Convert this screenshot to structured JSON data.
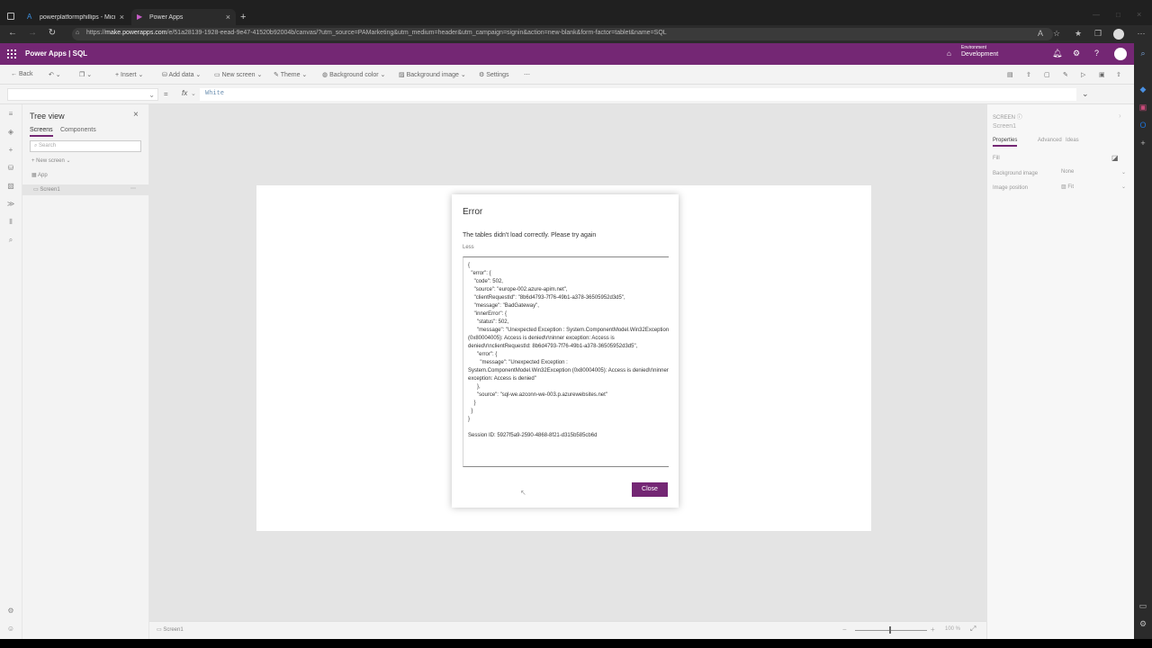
{
  "browser": {
    "tabs": [
      {
        "title": "powerplatformphillips - Microsoft..."
      },
      {
        "title": "Power Apps"
      }
    ],
    "url_prefix": "https://",
    "url_domain": "make.powerapps.com",
    "url_rest": "/e/51a28139-1928-eead-9e47-41520b92004b/canvas/?utm_source=PAMarketing&utm_medium=header&utm_campaign=signin&action=new-blank&form-factor=tablet&name=SQL"
  },
  "app": {
    "title": "Power Apps  |  SQL",
    "env_label": "Environment",
    "env_name": "Development"
  },
  "commands": {
    "back": "Back",
    "insert": "Insert",
    "add_data": "Add data",
    "new_screen": "New screen",
    "theme": "Theme",
    "background_color": "Background color",
    "background_image": "Background image",
    "settings": "Settings"
  },
  "formula": {
    "fx": "fx",
    "value": "White"
  },
  "tree": {
    "title": "Tree view",
    "tabs": [
      "Screens",
      "Components"
    ],
    "search_placeholder": "Search",
    "new_screen": "New screen",
    "items": [
      {
        "label": "App"
      },
      {
        "label": "Screen1"
      }
    ]
  },
  "props": {
    "header": "SCREEN",
    "name": "Screen1",
    "tabs": [
      "Properties",
      "Advanced",
      "Ideas"
    ],
    "fill_label": "Fill",
    "bg_image_label": "Background image",
    "bg_image_value": "None",
    "image_position_label": "Image position",
    "image_position_value": "Fit"
  },
  "status": {
    "screen": "Screen1",
    "zoom": "100 %"
  },
  "dialog": {
    "title": "Error",
    "message": "The tables didn't load correctly. Please try again",
    "less": "Less",
    "details": "{\n  \"error\": {\n    \"code\": 502,\n    \"source\": \"europe-002.azure-apim.net\",\n    \"clientRequestId\": \"8b6d4793-7f76-49b1-a378-36505952d3d5\",\n    \"message\": \"BadGateway\",\n    \"innerError\": {\n      \"status\": 502,\n      \"message\": \"Unexpected Exception : System.ComponentModel.Win32Exception (0x80004005): Access is denied\\r\\ninner exception: Access is denied\\r\\nclientRequestId: 8b6d4793-7f76-49b1-a378-36505952d3d5\",\n      \"error\": {\n        \"message\": \"Unexpected Exception : System.ComponentModel.Win32Exception (0x80004005): Access is denied\\r\\ninner exception: Access is denied\"\n      },\n      \"source\": \"sql-we.azconn-we-003.p.azurewebsites.net\"\n    }\n  }\n}\n\nSession ID: 5927f5a9-2590-4868-8f21-d315b585cb6d",
    "close": "Close"
  },
  "colors": {
    "brand": "#742774",
    "canvas": "#e4e4e4"
  }
}
